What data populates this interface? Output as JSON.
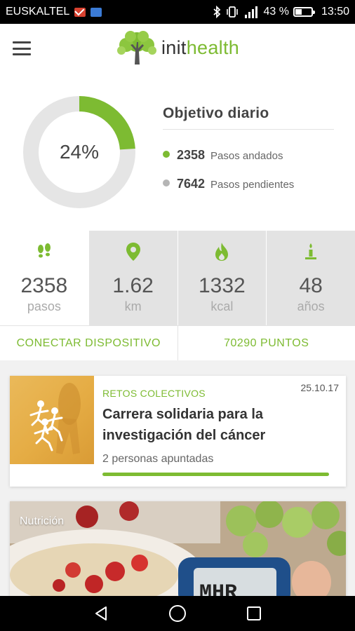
{
  "status_bar": {
    "carrier": "EUSKALTEL",
    "battery_percent": "43 %",
    "battery_level": 0.43,
    "time": "13:50",
    "icons": [
      "mail-icon",
      "image-icon",
      "bluetooth-icon",
      "vibrate-icon",
      "signal-icon",
      "battery-icon"
    ]
  },
  "header": {
    "logo_init": "init",
    "logo_health": "health",
    "menu_icon": "hamburger-menu-icon"
  },
  "daily_goal": {
    "title": "Objetivo diario",
    "percent_label": "24%",
    "progress": 0.24,
    "walked": {
      "value": "2358",
      "label": "Pasos andados",
      "color": "#7dbb32"
    },
    "pending": {
      "value": "7642",
      "label": "Pasos pendientes",
      "color": "#b5b5b5"
    }
  },
  "metrics": [
    {
      "icon": "footsteps-icon",
      "value": "2358",
      "unit": "pasos"
    },
    {
      "icon": "location-pin-icon",
      "value": "1.62",
      "unit": "km"
    },
    {
      "icon": "flame-icon",
      "value": "1332",
      "unit": "kcal"
    },
    {
      "icon": "birthday-candle-icon",
      "value": "48",
      "unit": "años"
    }
  ],
  "actions": {
    "connect": "CONECTAR DISPOSITIVO",
    "points": "70290 PUNTOS"
  },
  "challenge": {
    "category": "RETOS COLECTIVOS",
    "date": "25.10.17",
    "title": "Carrera solidaria para la investigación del cáncer",
    "subtitle": "2 personas apuntadas",
    "progress": 1.0
  },
  "nutrition": {
    "label": "Nutrición",
    "device_reading": "MHR"
  },
  "colors": {
    "accent": "#7dbb32",
    "track": "#e5e5e5",
    "tile_shade": "#e3e3e3"
  }
}
